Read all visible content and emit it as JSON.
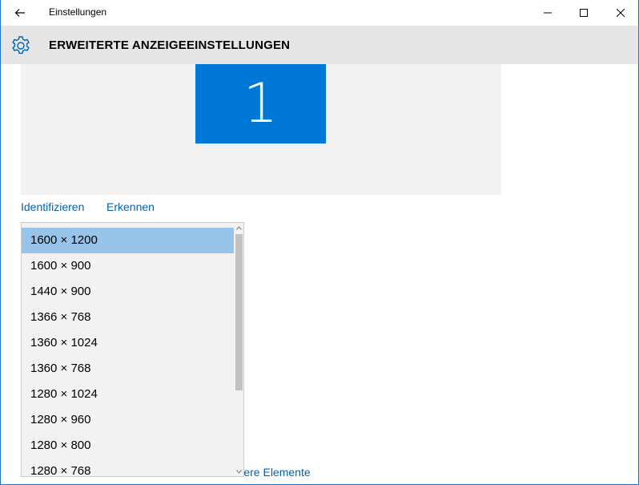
{
  "window": {
    "title": "Einstellungen"
  },
  "header": {
    "title": "ERWEITERTE ANZEIGEEINSTELLUNGEN",
    "icon": "gear-icon"
  },
  "preview": {
    "monitor_number": "1",
    "accent_color": "#0078d7"
  },
  "links": {
    "identify": "Identifizieren",
    "detect": "Erkennen"
  },
  "resolution_dropdown": {
    "selected": "1600 × 1200",
    "options": [
      "1600 × 1200",
      "1600 × 900",
      "1440 × 900",
      "1366 × 768",
      "1360 × 1024",
      "1360 × 768",
      "1280 × 1024",
      "1280 × 960",
      "1280 × 800",
      "1280 × 768"
    ]
  },
  "bottom_link": {
    "visible_tail": "andere Elemente"
  }
}
